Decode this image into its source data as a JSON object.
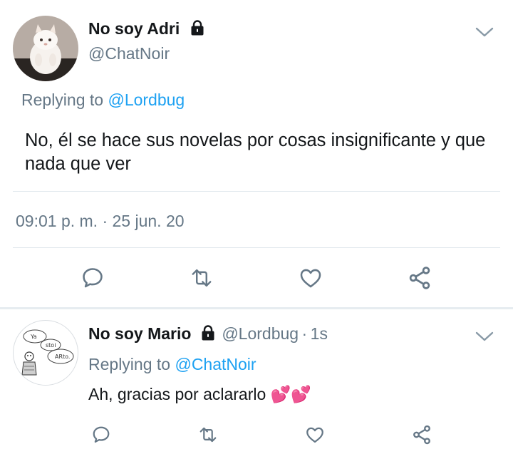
{
  "main_tweet": {
    "display_name": "No soy Adri",
    "handle": "@ChatNoir",
    "replying_prefix": "Replying to",
    "replying_to": "@Lordbug",
    "text": "No, él se hace sus novelas por cosas insignificante y que nada que ver",
    "timestamp": "09:01 p. m. · 25 jun. 20",
    "protected_icon": "lock-icon",
    "menu_icon": "chevron-down-icon"
  },
  "actions": {
    "icons": [
      "comment-icon",
      "retweet-icon",
      "heart-icon",
      "share-icon"
    ],
    "color": "#657786"
  },
  "reply_tweet": {
    "display_name": "No soy Mario",
    "handle": "@Lordbug",
    "separator": "·",
    "time": "1s",
    "replying_prefix": "Replying to",
    "replying_to": "@ChatNoir",
    "text": "Ah, gracias por aclararlo",
    "emoji": "💕💕",
    "avatar_text": [
      "Ya",
      "stoi",
      "ARto."
    ],
    "protected_icon": "lock-icon",
    "menu_icon": "chevron-down-icon"
  },
  "colors": {
    "link": "#1da1f2",
    "secondary": "#657786",
    "divider": "#e1e8ed",
    "emoji": "#ff3aa0"
  }
}
